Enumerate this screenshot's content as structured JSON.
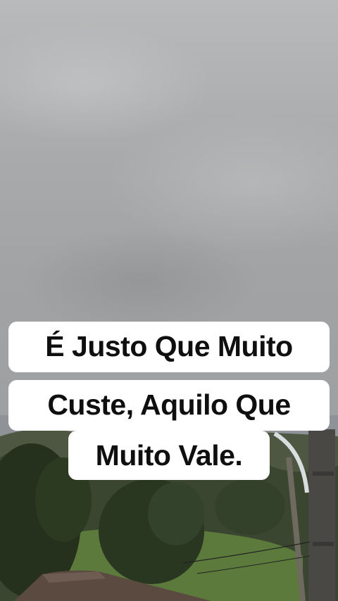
{
  "caption": {
    "line1": "É Justo Que Muito",
    "line2": "Custe, Aquilo Que",
    "line3": "Muito Vale."
  },
  "colors": {
    "caption_background": "#ffffff",
    "caption_text": "#0f0f0f",
    "sky": "#a9aaab",
    "foliage": "#2f3b24"
  }
}
